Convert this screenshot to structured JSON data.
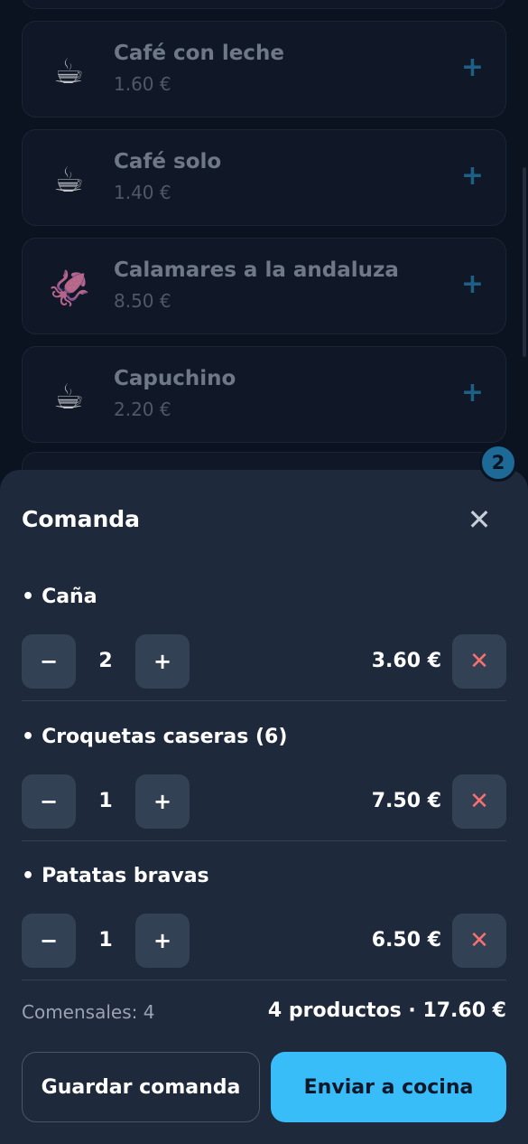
{
  "menu": {
    "items": [
      {
        "emoji": "☕",
        "name": "Café con leche",
        "price": "1.60 €"
      },
      {
        "emoji": "☕",
        "name": "Café solo",
        "price": "1.40 €"
      },
      {
        "emoji": "🦑",
        "name": "Calamares a la andaluza",
        "price": "8.50 €"
      },
      {
        "emoji": "☕",
        "name": "Capuchino",
        "price": "2.20 €"
      }
    ],
    "add_icon": "+",
    "cart_count": "2"
  },
  "order": {
    "title": "Comanda",
    "close_icon": "✕",
    "items": [
      {
        "name": "Caña",
        "qty": "2",
        "price": "3.60 €"
      },
      {
        "name": "Croquetas caseras (6)",
        "qty": "1",
        "price": "7.50 €"
      },
      {
        "name": "Patatas bravas",
        "qty": "1",
        "price": "6.50 €"
      }
    ],
    "bullet": "•",
    "minus_icon": "−",
    "plus_icon": "+",
    "remove_icon": "✕",
    "diners": "Comensales: 4",
    "summary": "4 productos · 17.60 €",
    "save_label": "Guardar comanda",
    "send_label": "Enviar a cocina"
  },
  "colors": {
    "accent": "#38bdf8",
    "sheet_bg": "#1e293b",
    "remove": "#f87171"
  }
}
